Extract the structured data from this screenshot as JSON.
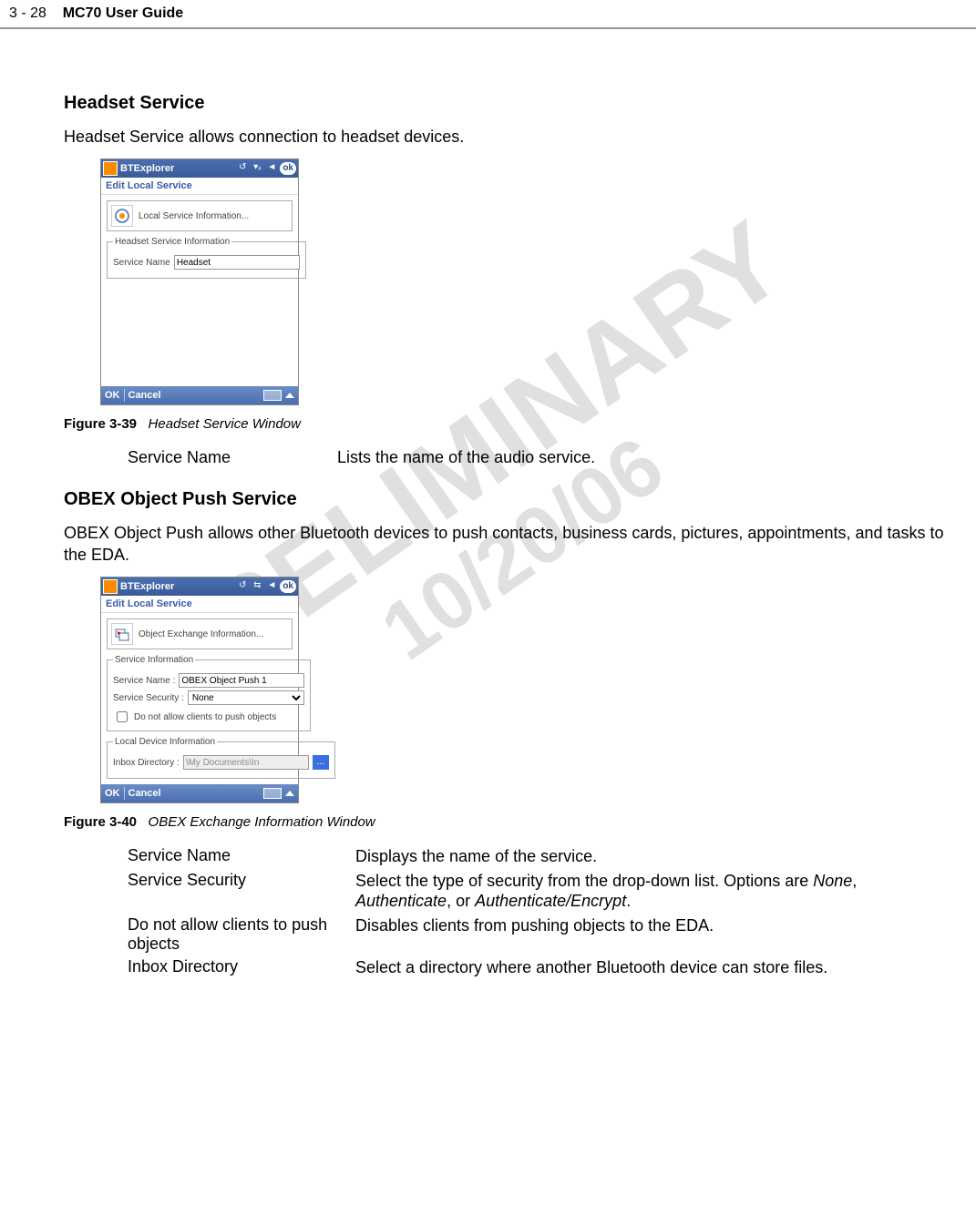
{
  "watermark_line1": "PRELIMINARY",
  "watermark_line2": "10/20/06",
  "header": {
    "page_num": "3 - 28",
    "guide_title": "MC70 User Guide"
  },
  "section1": {
    "title": "Headset Service",
    "intro": "Headset Service allows connection to headset devices.",
    "figure_num": "Figure 3-39",
    "figure_title": "Headset Service Window",
    "term": "Service Name",
    "desc": "Lists the name of the audio service."
  },
  "mock1": {
    "app_title": "BTExplorer",
    "ok": "ok",
    "subtitle": "Edit Local Service",
    "info_text": "Local Service Information...",
    "fieldset_legend": "Headset Service Information",
    "label_service_name": "Service Name",
    "value_service_name": "Headset",
    "btn_ok": "OK",
    "btn_cancel": "Cancel"
  },
  "section2": {
    "title": "OBEX Object Push Service",
    "intro": "OBEX Object Push allows other Bluetooth devices to push contacts, business cards, pictures, appointments, and tasks to the EDA.",
    "figure_num": "Figure 3-40",
    "figure_title": "OBEX Exchange Information Window",
    "rows": [
      {
        "term": "Service Name",
        "desc": "Displays the name of the service."
      },
      {
        "term": "Service Security",
        "desc": "Select the type of security from the drop-down list. Options are ",
        "i1": "None",
        "c1": ", ",
        "i2": "Authenticate",
        "c2": ", or ",
        "i3": "Authenticate/Encrypt",
        "c3": "."
      },
      {
        "term": "Do not allow clients to push objects",
        "desc": "Disables clients from pushing objects to the EDA."
      },
      {
        "term": "Inbox Directory",
        "desc": "Select a directory where another Bluetooth device can store files."
      }
    ]
  },
  "mock2": {
    "app_title": "BTExplorer",
    "ok": "ok",
    "subtitle": "Edit Local Service",
    "info_text": "Object Exchange Information...",
    "fieldset1_legend": "Service Information",
    "label_service_name": "Service Name :",
    "value_service_name": "OBEX Object Push 1",
    "label_service_security": "Service Security :",
    "value_service_security": "None",
    "chk_label": "Do not allow clients to push objects",
    "fieldset2_legend": "Local Device Information",
    "label_inbox": "Inbox Directory :",
    "value_inbox": "\\My Documents\\In",
    "dots": "...",
    "btn_ok": "OK",
    "btn_cancel": "Cancel"
  }
}
